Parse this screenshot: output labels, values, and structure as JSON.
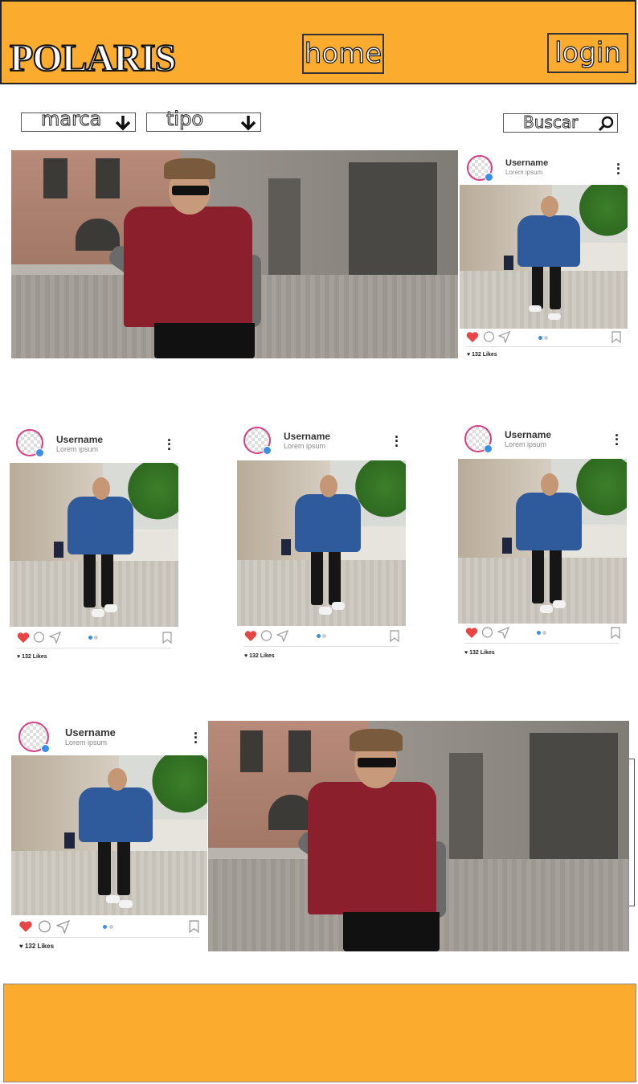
{
  "header": {
    "logo": "POLARIS",
    "home_label": "home",
    "login_label": "login"
  },
  "filters": {
    "marca_label": "marca",
    "tipo_label": "tipo",
    "search_label": "Buscar"
  },
  "posts": [
    {
      "username": "Username",
      "subtitle": "Lorem ipsum",
      "likes": "132 Likes"
    },
    {
      "username": "Username",
      "subtitle": "Lorem ipsum",
      "likes": "132 Likes"
    },
    {
      "username": "Username",
      "subtitle": "Lorem ipsum",
      "likes": "132 Likes"
    },
    {
      "username": "Username",
      "subtitle": "Lorem ipsum",
      "likes": "132 Likes"
    },
    {
      "username": "Username",
      "subtitle": "Lorem ipsum",
      "likes": "132 Likes"
    }
  ],
  "colors": {
    "accent": "#fbab2d",
    "like_red": "#e84545",
    "verified_blue": "#3b8ee8"
  },
  "icons": {
    "filter_arrow": "arrow-down-icon",
    "search": "search-icon",
    "like": "heart-icon",
    "comment": "comment-icon",
    "share": "send-icon",
    "save": "bookmark-icon",
    "menu": "more-vertical-icon"
  }
}
